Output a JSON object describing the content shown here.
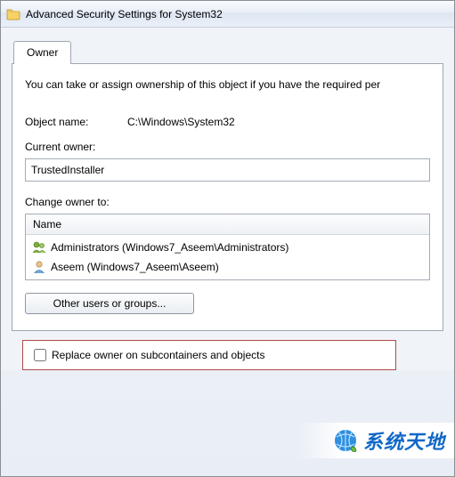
{
  "window": {
    "title": "Advanced Security Settings for System32"
  },
  "tabs": [
    {
      "label": "Owner",
      "active": true
    }
  ],
  "panel": {
    "intro": "You can take or assign ownership of this object if you have the required per",
    "object_name_label": "Object name:",
    "object_name_value": "C:\\Windows\\System32",
    "current_owner_label": "Current owner:",
    "current_owner_value": "TrustedInstaller",
    "change_owner_label": "Change owner to:",
    "list_header": "Name",
    "owner_candidates": [
      {
        "icon": "group",
        "label": "Administrators (Windows7_Aseem\\Administrators)"
      },
      {
        "icon": "user",
        "label": "Aseem (Windows7_Aseem\\Aseem)"
      }
    ],
    "other_users_button": "Other users or groups...",
    "replace_checkbox_label": "Replace owner on subcontainers and objects",
    "replace_checked": false
  },
  "watermark": "系统天地"
}
